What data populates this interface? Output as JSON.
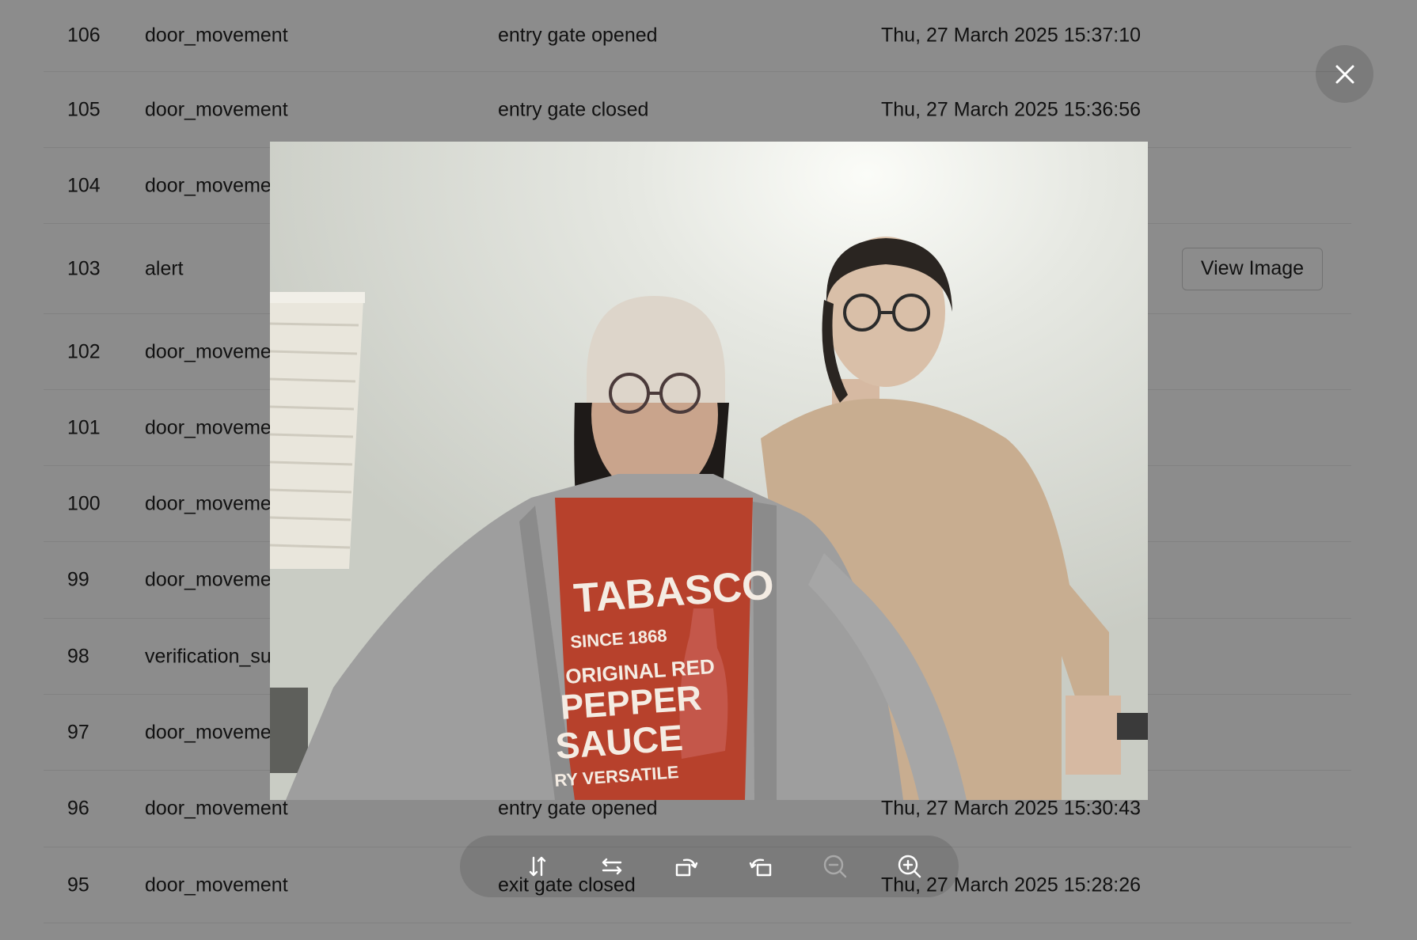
{
  "table": {
    "rows": [
      {
        "id": "106",
        "type": "door_movement",
        "description": "entry gate opened",
        "time": "Thu, 27 March 2025 15:37:10"
      },
      {
        "id": "105",
        "type": "door_movement",
        "description": "entry gate closed",
        "time": "Thu, 27 March 2025 15:36:56"
      },
      {
        "id": "104",
        "type": "door_moveme",
        "description": "",
        "time": ""
      },
      {
        "id": "103",
        "type": "alert",
        "description": "",
        "time": "",
        "action": "View Image"
      },
      {
        "id": "102",
        "type": "door_moveme",
        "description": "",
        "time": ""
      },
      {
        "id": "101",
        "type": "door_moveme",
        "description": "",
        "time": ""
      },
      {
        "id": "100",
        "type": "door_moveme",
        "description": "",
        "time": ""
      },
      {
        "id": "99",
        "type": "door_moveme",
        "description": "",
        "time": ""
      },
      {
        "id": "98",
        "type": "verification_suc",
        "description": "",
        "time": ""
      },
      {
        "id": "97",
        "type": "door_moveme",
        "description": "",
        "time": ""
      },
      {
        "id": "96",
        "type": "door_movement",
        "description": "entry gate opened",
        "time": "Thu, 27 March 2025 15:30:43"
      },
      {
        "id": "95",
        "type": "door_movement",
        "description": "exit gate closed",
        "time": "Thu, 27 March 2025 15:28:26"
      }
    ]
  },
  "preview_image": {
    "shirt_text": [
      "TABASCO",
      "SINCE 1868",
      "ORIGINAL RED",
      "PEPPER",
      "SAUCE",
      "RY VERSATILE"
    ]
  },
  "toolbar": {
    "tools": [
      {
        "icon": "flip-vertical-icon",
        "enabled": true
      },
      {
        "icon": "flip-horizontal-icon",
        "enabled": true
      },
      {
        "icon": "rotate-left-icon",
        "enabled": true
      },
      {
        "icon": "rotate-right-icon",
        "enabled": true
      },
      {
        "icon": "zoom-out-icon",
        "enabled": false
      },
      {
        "icon": "zoom-in-icon",
        "enabled": true
      }
    ]
  },
  "colors": {
    "mask": "#000000",
    "shirt_red": "#b7412c",
    "beanie": "#ddd5ca",
    "hoodie": "#9e9e9e",
    "tan_shirt": "#c8ad90"
  }
}
